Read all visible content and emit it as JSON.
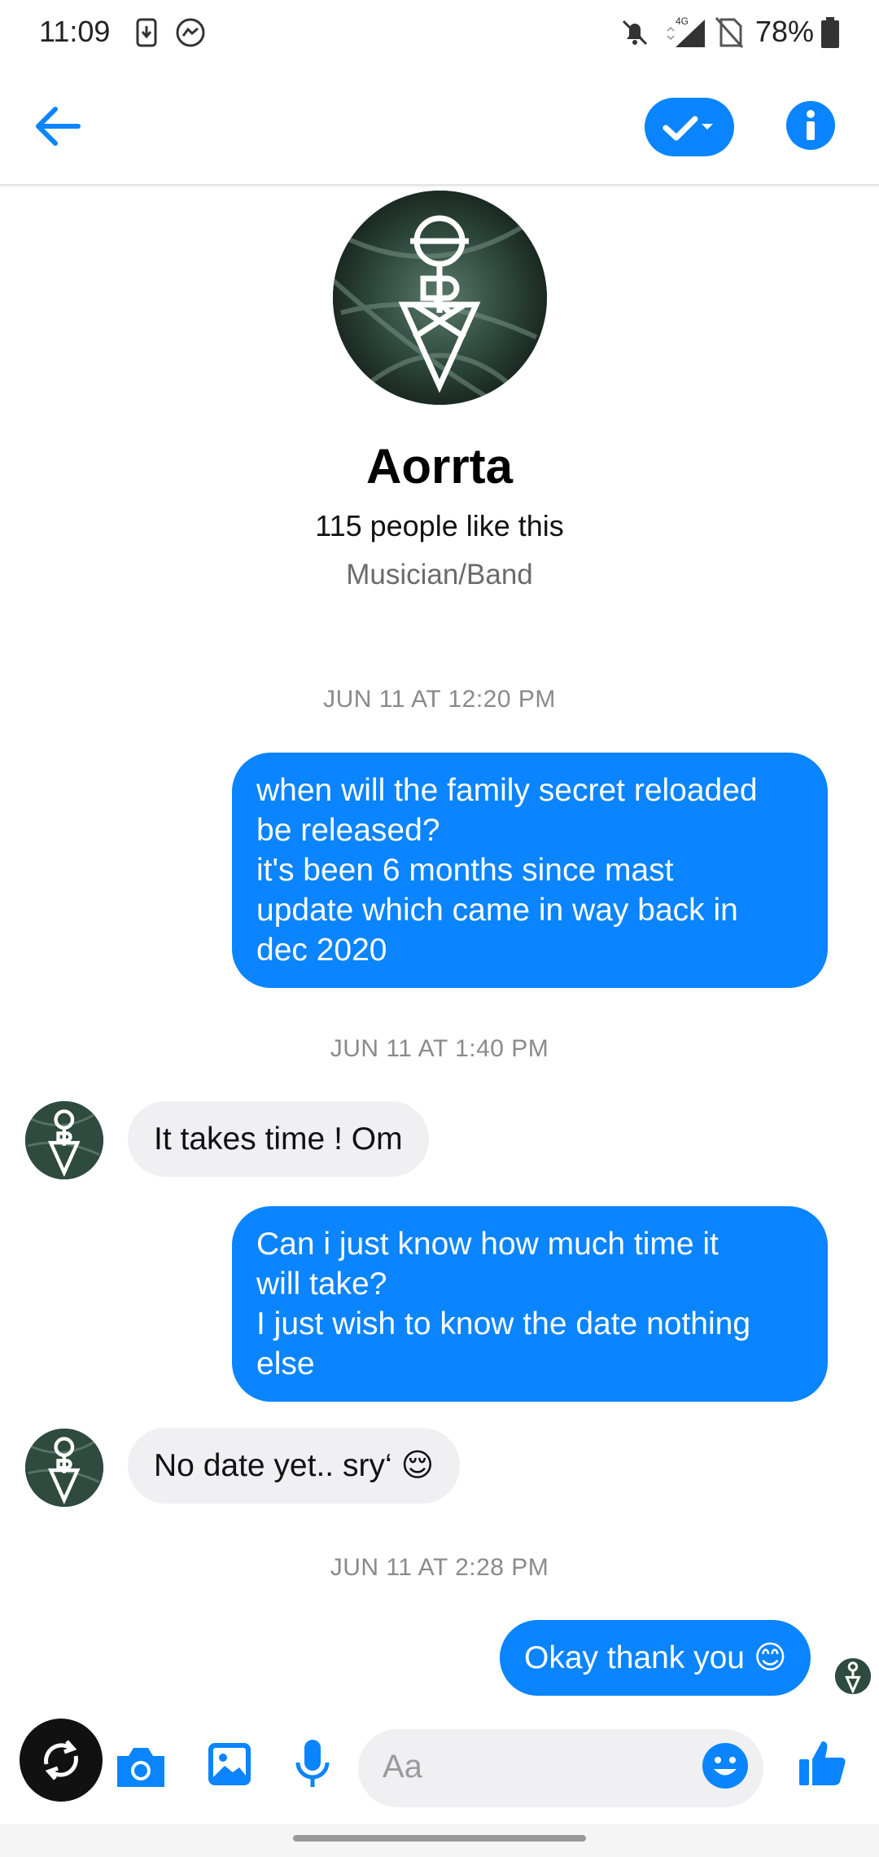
{
  "status_bar": {
    "time": "11:09",
    "battery": "78%",
    "network": "4G"
  },
  "header": {
    "back_icon": "arrow-left-icon",
    "check_icon": "check-dropdown-icon",
    "info_icon": "info-icon"
  },
  "profile": {
    "name": "Aorrta",
    "likes": "115 people like this",
    "category": "Musician/Band"
  },
  "conversation": {
    "ts1": "JUN 11 AT 12:20 PM",
    "msg1": {
      "lines": [
        "when will the family secret reloaded",
        "be released?",
        "it's been 6 months since mast",
        "update which came in way back in",
        "dec 2020"
      ]
    },
    "ts2": "JUN 11 AT 1:40 PM",
    "msg2": {
      "text": "It takes time ! Om"
    },
    "msg3": {
      "lines": [
        "Can i just know how much time it",
        "will take?",
        "I just wish to know the date nothing",
        "else"
      ]
    },
    "msg4": {
      "text": "No date yet.. sry‘ 😌"
    },
    "ts3": "JUN 11 AT 2:28 PM",
    "msg5": {
      "text": "Okay thank you 😊"
    }
  },
  "composer": {
    "placeholder": "Aa",
    "icons": [
      "switch-icon",
      "camera-icon",
      "gallery-icon",
      "microphone-icon",
      "emoji-icon",
      "thumbs-up-icon"
    ]
  },
  "colors": {
    "accent": "#0a84ff",
    "incoming_bubble": "#f0eff2"
  }
}
